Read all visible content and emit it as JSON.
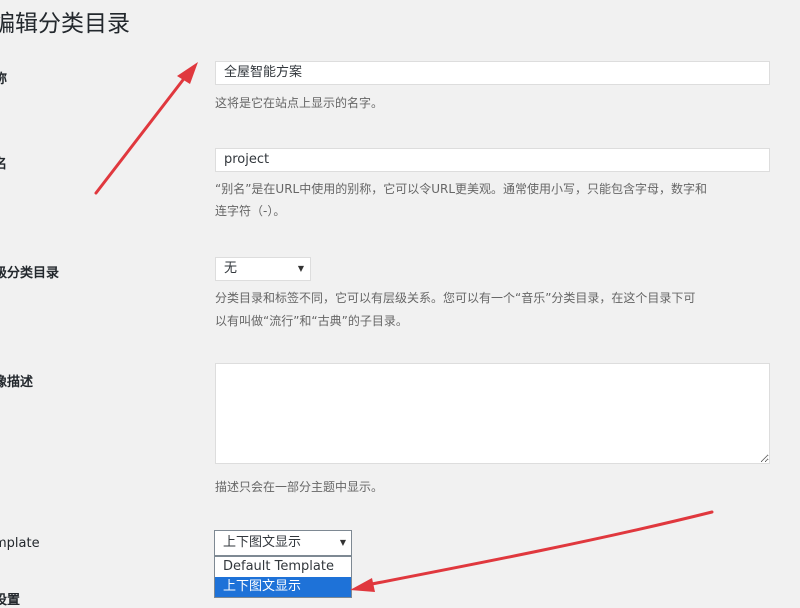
{
  "page_title": "编辑分类目录",
  "fields": {
    "name": {
      "label": "称",
      "value": "全屋智能方案",
      "description": "这将是它在站点上显示的名字。"
    },
    "slug": {
      "label": "名",
      "value": "project",
      "description_line1": "“别名”是在URL中使用的别称，它可以令URL更美观。通常使用小写，只能包含字母，数字和",
      "description_line2": "连字符（-）。"
    },
    "parent": {
      "label": "级分类目录",
      "selected": "无",
      "description_line1": "分类目录和标签不同，它可以有层级关系。您可以有一个“音乐”分类目录，在这个目录下可",
      "description_line2": "以有叫做“流行”和“古典”的子目录。"
    },
    "description": {
      "label": "像描述",
      "value": "",
      "help": "描述只会在一部分主题中显示。"
    },
    "template": {
      "label": "mplate",
      "selected": "上下图文显示",
      "options": [
        "Default Template",
        "上下图文显示"
      ]
    },
    "settings": {
      "label": "设置"
    }
  },
  "icons": {
    "select_chevron": "▼"
  },
  "colors": {
    "annotation_arrow": "#e0383e",
    "highlight": "#1e72d8"
  }
}
